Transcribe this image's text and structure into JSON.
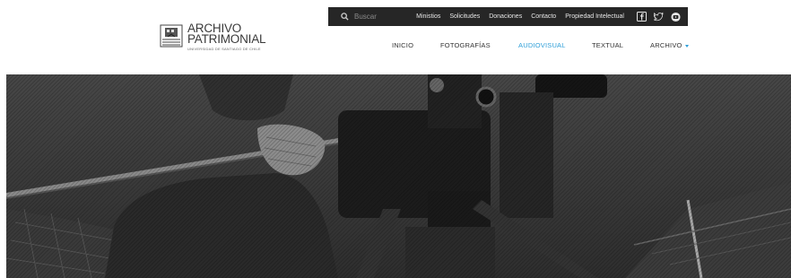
{
  "logo": {
    "line1": "ARCHIVO",
    "line2": "PATRIMONIAL",
    "subtitle": "UNIVERSIDAD DE SANTIAGO DE CHILE"
  },
  "topbar": {
    "search_placeholder": "Buscar",
    "links": [
      "Ministios",
      "Solicitudes",
      "Donaciones",
      "Contacto",
      "Propiedad Intelectual"
    ],
    "socials": [
      "facebook-icon",
      "twitter-icon",
      "youtube-icon"
    ]
  },
  "nav": {
    "items": [
      "INICIO",
      "FOTOGRAFÍAS",
      "AUDIOVISUAL",
      "TEXTUAL",
      "ARCHIVO"
    ],
    "active": "AUDIOVISUAL"
  },
  "colors": {
    "accent": "#2f9fd8",
    "topbar_bg": "#262626",
    "nav_text": "#333333"
  },
  "hero": {
    "image": "black-and-white photo of a camera operator filming with a tripod-mounted film camera"
  }
}
